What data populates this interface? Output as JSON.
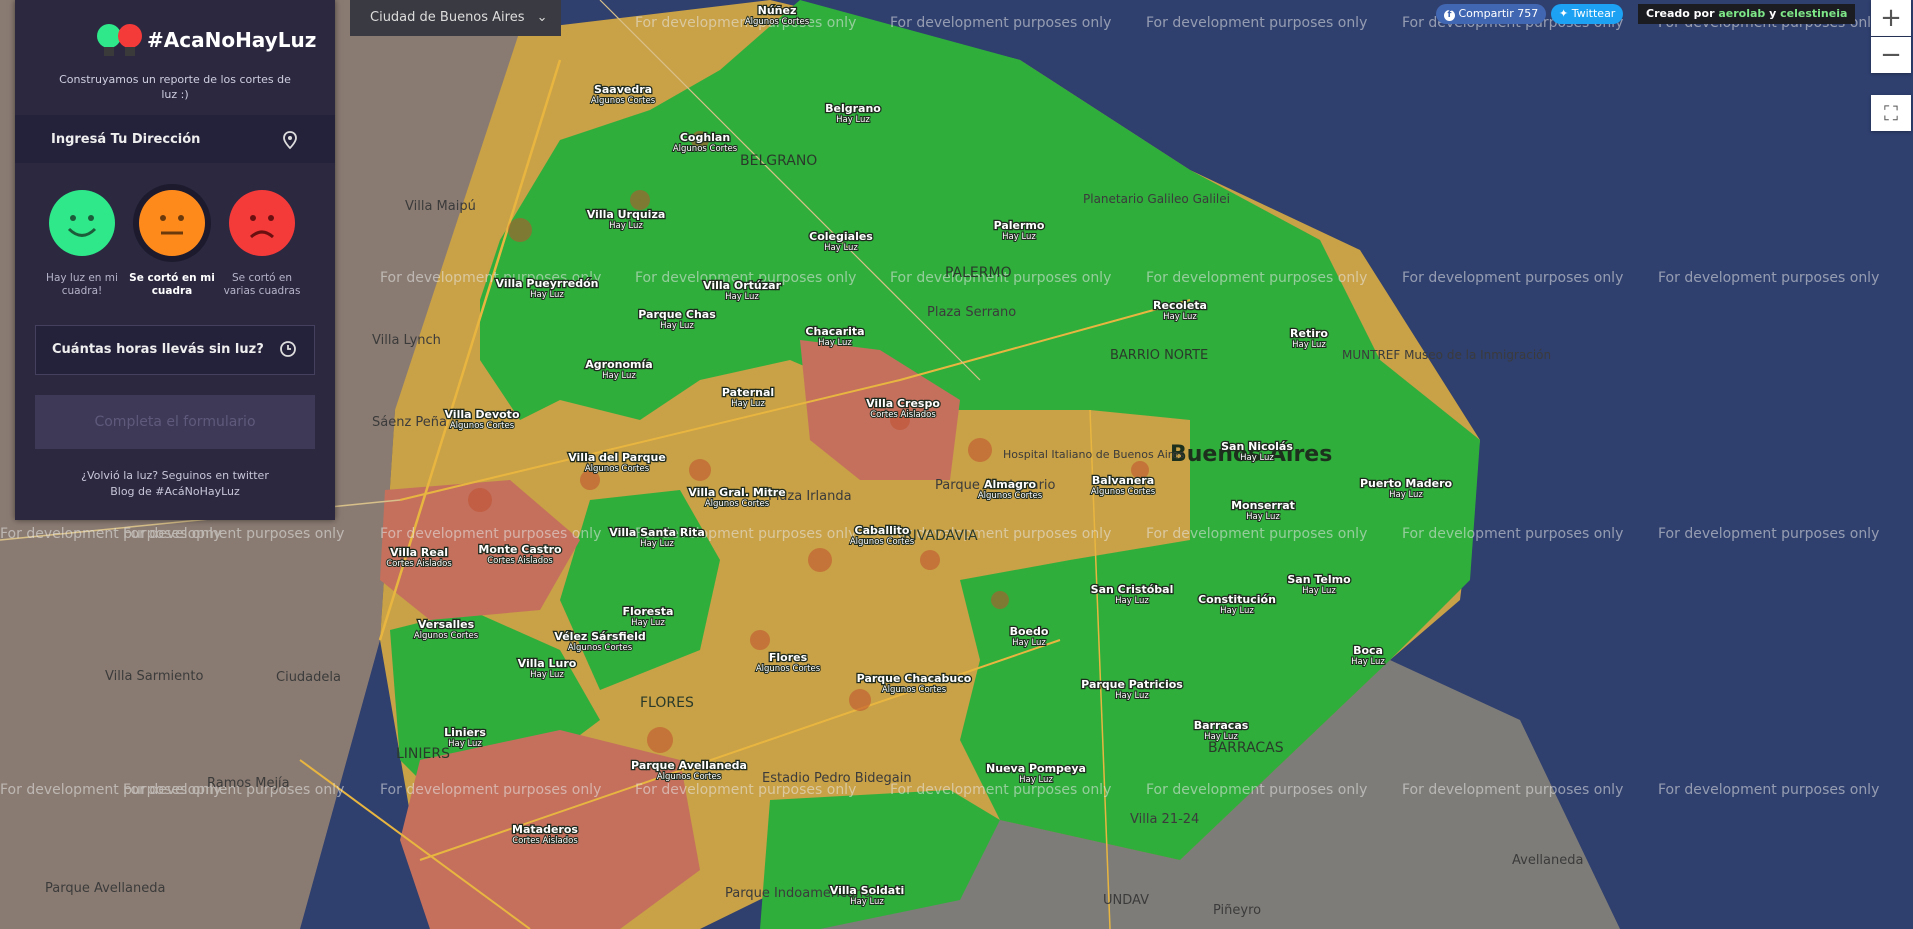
{
  "app": {
    "title": "#AcaNoHayLuz",
    "subtitle": "Construyamos un reporte de los cortes de luz :)",
    "address_label": "Ingresá Tu Dirección",
    "status_options": [
      {
        "label": "Hay luz en mi cuadra!",
        "color": "#2ee88a",
        "selected": false
      },
      {
        "label": "Se cortó en mi cuadra",
        "color": "#ff8a1c",
        "selected": true
      },
      {
        "label": "Se cortó en varias cuadras",
        "color": "#f53a3a",
        "selected": false
      }
    ],
    "hours_label": "Cuántas horas llevás sin luz?",
    "submit_label": "Completa el formulario",
    "footer_line1": "¿Volvió la luz? Seguinos en twitter",
    "footer_line2": "Blog de #AcáNoHayLuz"
  },
  "header": {
    "city_select": "Ciudad de Buenos Aires",
    "share_facebook": "Compartir 757",
    "share_twitter": "Twittear",
    "credit_prefix": "Creado por",
    "credit_a": "aerolab",
    "credit_and": "y",
    "credit_b": "celestineia"
  },
  "map_controls": {
    "zoom_in": "+",
    "zoom_out": "−",
    "fullscreen": "⛶"
  },
  "watermark": "For development purposes only",
  "legend_colors": {
    "hay_luz": "#2fae3c",
    "algunos_cortes": "#c9a146",
    "cortes_aislados": "#c4705d",
    "water": "#2f3f6e"
  },
  "neighborhoods": [
    {
      "name": "Núñez",
      "status": "Algunos Cortes"
    },
    {
      "name": "Saavedra",
      "status": "Algunos Cortes"
    },
    {
      "name": "Belgrano",
      "status": "Hay Luz"
    },
    {
      "name": "Coghlan",
      "status": "Algunos Cortes"
    },
    {
      "name": "Villa Urquiza",
      "status": "Hay Luz"
    },
    {
      "name": "Colegiales",
      "status": "Hay Luz"
    },
    {
      "name": "Palermo",
      "status": "Hay Luz"
    },
    {
      "name": "Villa Pueyrredón",
      "status": "Hay Luz"
    },
    {
      "name": "Villa Ortúzar",
      "status": "Hay Luz"
    },
    {
      "name": "Recoleta",
      "status": "Hay Luz"
    },
    {
      "name": "Parque Chas",
      "status": "Hay Luz"
    },
    {
      "name": "Chacarita",
      "status": "Hay Luz"
    },
    {
      "name": "Retiro",
      "status": "Hay Luz"
    },
    {
      "name": "Agronomía",
      "status": "Hay Luz"
    },
    {
      "name": "Paternal",
      "status": "Hay Luz"
    },
    {
      "name": "Villa Crespo",
      "status": "Cortes Aislados"
    },
    {
      "name": "Villa Devoto",
      "status": "Algunos Cortes"
    },
    {
      "name": "San Nicolás",
      "status": "Hay Luz"
    },
    {
      "name": "Villa del Parque",
      "status": "Algunos Cortes"
    },
    {
      "name": "Almagro",
      "status": "Algunos Cortes"
    },
    {
      "name": "Balvanera",
      "status": "Algunos Cortes"
    },
    {
      "name": "Puerto Madero",
      "status": "Hay Luz"
    },
    {
      "name": "Villa Gral. Mitre",
      "status": "Algunos Cortes"
    },
    {
      "name": "Monserrat",
      "status": "Hay Luz"
    },
    {
      "name": "Villa Santa Rita",
      "status": "Hay Luz"
    },
    {
      "name": "Caballito",
      "status": "Algunos Cortes"
    },
    {
      "name": "Villa Real",
      "status": "Cortes Aislados"
    },
    {
      "name": "Monte Castro",
      "status": "Cortes Aislados"
    },
    {
      "name": "San Telmo",
      "status": "Hay Luz"
    },
    {
      "name": "San Cristóbal",
      "status": "Hay Luz"
    },
    {
      "name": "Constitución",
      "status": "Hay Luz"
    },
    {
      "name": "Floresta",
      "status": "Hay Luz"
    },
    {
      "name": "Versalles",
      "status": "Algunos Cortes"
    },
    {
      "name": "Vélez Sársfield",
      "status": "Algunos Cortes"
    },
    {
      "name": "Boedo",
      "status": "Hay Luz"
    },
    {
      "name": "Boca",
      "status": "Hay Luz"
    },
    {
      "name": "Villa Luro",
      "status": "Hay Luz"
    },
    {
      "name": "Flores",
      "status": "Algunos Cortes"
    },
    {
      "name": "Parque Chacabuco",
      "status": "Algunos Cortes"
    },
    {
      "name": "Parque Patricios",
      "status": "Hay Luz"
    },
    {
      "name": "Liniers",
      "status": "Hay Luz"
    },
    {
      "name": "Barracas",
      "status": "Hay Luz"
    },
    {
      "name": "Parque Avellaneda",
      "status": "Algunos Cortes"
    },
    {
      "name": "Nueva Pompeya",
      "status": "Hay Luz"
    },
    {
      "name": "Mataderos",
      "status": "Cortes Aislados"
    },
    {
      "name": "Villa Soldati",
      "status": "Hay Luz"
    }
  ],
  "places": [
    "Villa Maipú",
    "Sáenz Peña",
    "Villa Lynch",
    "Ciudadela",
    "Villa Sarmiento",
    "Ramos Mejía",
    "Parque Avellaneda",
    "Plaza Serrano",
    "Planetario Galileo Galilei",
    "MUNTREF Museo de la Inmigración",
    "Buenos Aires",
    "Plaza Irlanda",
    "Parque Centenario",
    "Hospital Italiano de Buenos Aires",
    "Villa 21-24",
    "Avellaneda",
    "Piñeyro",
    "UNDAV",
    "Estadio Pedro Bidegain",
    "Parque Indoamericano",
    "BELGRANO",
    "PALERMO",
    "BARRIO NORTE",
    "RIVADAVIA",
    "LINIERS",
    "FLORES",
    "BARRACAS"
  ]
}
